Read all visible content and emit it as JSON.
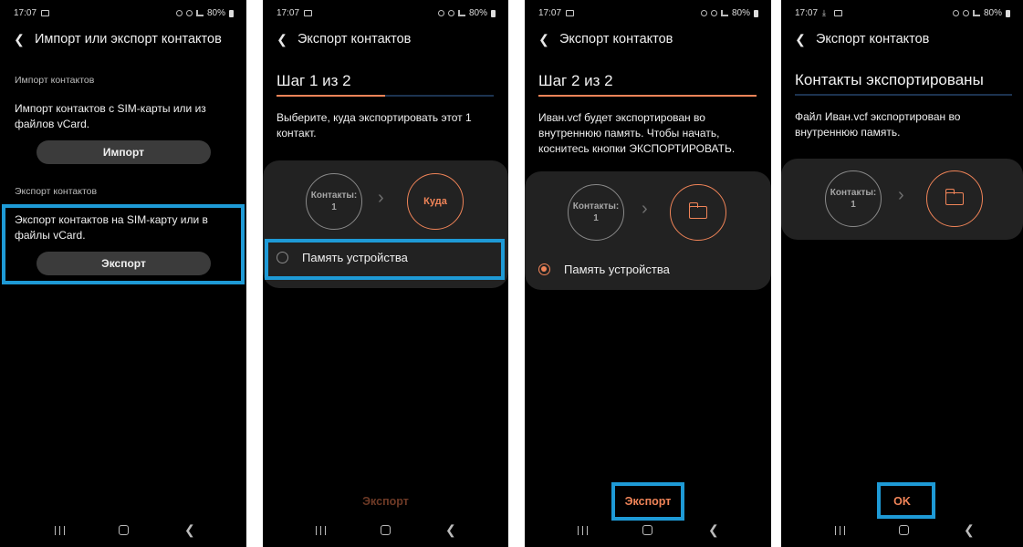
{
  "status": {
    "time": "17:07",
    "battery": "80%"
  },
  "screen1": {
    "title": "Импорт или экспорт контактов",
    "import_section": "Импорт контактов",
    "import_text": "Импорт контактов с SIM-карты или из файлов vCard.",
    "import_button": "Импорт",
    "export_section": "Экспорт контактов",
    "export_text": "Экспорт контактов на SIM-карту или в файлы vCard.",
    "export_button": "Экспорт"
  },
  "screen2": {
    "title": "Экспорт контактов",
    "step": "Шаг 1 из 2",
    "progress": 0.5,
    "description": "Выберите, куда экспортировать этот 1 контакт.",
    "source_label": "Контакты:",
    "source_count": "1",
    "target_label": "Куда",
    "option": "Память устройства",
    "option_selected": false,
    "action": "Экспорт"
  },
  "screen3": {
    "title": "Экспорт контактов",
    "step": "Шаг 2 из 2",
    "progress": 1.0,
    "description": "Иван.vcf будет экспортирован во внутреннюю память. Чтобы начать, коснитесь кнопки ЭКСПОРТИРОВАТЬ.",
    "source_label": "Контакты:",
    "source_count": "1",
    "target_icon": "folder-icon",
    "option": "Память устройства",
    "option_selected": true,
    "action": "Экспорт"
  },
  "screen4": {
    "title": "Экспорт контактов",
    "heading": "Контакты экспортированы",
    "description": "Файл Иван.vcf экспортирован во внутреннюю память.",
    "source_label": "Контакты:",
    "source_count": "1",
    "target_icon": "folder-icon",
    "action": "OK"
  },
  "colors": {
    "accent": "#f08458",
    "highlight": "#1e9ad6",
    "background": "#000000",
    "card": "#222222"
  }
}
